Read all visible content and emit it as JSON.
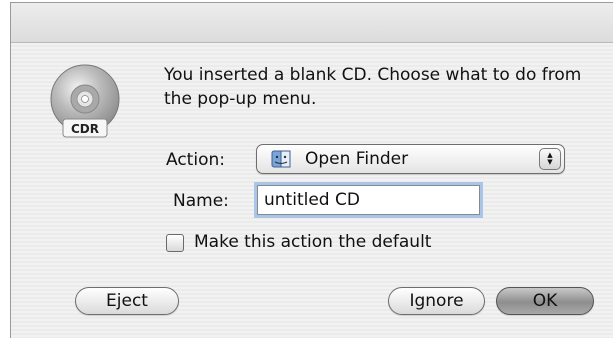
{
  "dialog": {
    "icon": {
      "label": "CDR",
      "semantic": "cd-disc-icon"
    },
    "message": "You inserted a blank CD. Choose what to do from the pop-up menu.",
    "action": {
      "label": "Action:",
      "selected": "Open Finder",
      "icon": "finder-icon"
    },
    "name": {
      "label": "Name:",
      "value": "untitled CD"
    },
    "default_checkbox": {
      "label": "Make this action the default",
      "checked": false
    },
    "buttons": {
      "eject": "Eject",
      "ignore": "Ignore",
      "ok": "OK"
    }
  }
}
